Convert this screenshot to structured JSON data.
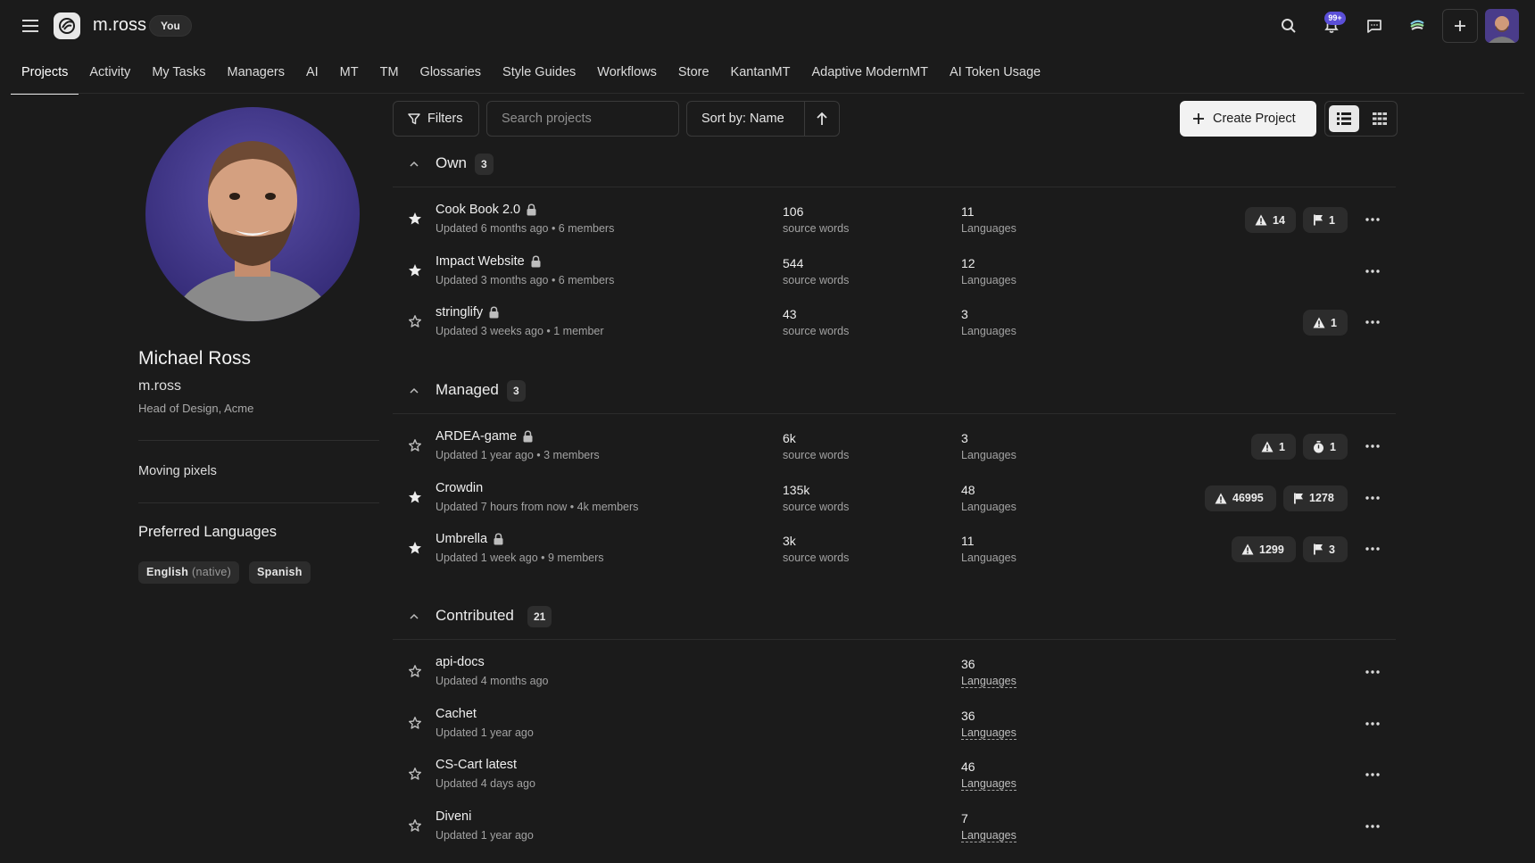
{
  "header": {
    "username": "m.ross",
    "you_badge": "You",
    "notifications_badge": "99+"
  },
  "nav": {
    "tabs": [
      "Projects",
      "Activity",
      "My Tasks",
      "Managers",
      "AI",
      "MT",
      "TM",
      "Glossaries",
      "Style Guides",
      "Workflows",
      "Store",
      "KantanMT",
      "Adaptive ModernMT",
      "AI Token Usage"
    ],
    "active": "Projects"
  },
  "profile": {
    "name": "Michael Ross",
    "handle": "m.ross",
    "title": "Head of Design, Acme",
    "bio": "Moving pixels",
    "preferred_heading": "Preferred Languages",
    "languages": [
      {
        "label": "English",
        "note": "(native)"
      },
      {
        "label": "Spanish",
        "note": ""
      }
    ]
  },
  "toolbar": {
    "filters_label": "Filters",
    "search_placeholder": "Search projects",
    "sort_label": "Sort by: Name",
    "create_label": "Create Project"
  },
  "sections": [
    {
      "title": "Own",
      "count": "3",
      "projects": [
        {
          "name": "Cook Book 2.0",
          "locked": true,
          "starred": true,
          "meta": "Updated 6 months ago • 6 members",
          "words": "106",
          "words_label": "source words",
          "langs": "11",
          "langs_label": "Languages",
          "pills": [
            {
              "icon": "warning-icon",
              "value": "14"
            },
            {
              "icon": "flag-icon",
              "value": "1"
            }
          ]
        },
        {
          "name": "Impact Website",
          "locked": true,
          "starred": true,
          "meta": "Updated 3 months ago • 6 members",
          "words": "544",
          "words_label": "source words",
          "langs": "12",
          "langs_label": "Languages",
          "pills": []
        },
        {
          "name": "stringlify",
          "locked": true,
          "starred": false,
          "meta": "Updated 3 weeks ago • 1 member",
          "words": "43",
          "words_label": "source words",
          "langs": "3",
          "langs_label": "Languages",
          "pills": [
            {
              "icon": "warning-icon",
              "value": "1"
            }
          ]
        }
      ]
    },
    {
      "title": "Managed",
      "count": "3",
      "projects": [
        {
          "name": "ARDEA-game",
          "locked": true,
          "starred": false,
          "meta": "Updated 1 year ago • 3 members",
          "words": "6k",
          "words_label": "source words",
          "langs": "3",
          "langs_label": "Languages",
          "pills": [
            {
              "icon": "warning-icon",
              "value": "1"
            },
            {
              "icon": "timer-icon",
              "value": "1"
            }
          ]
        },
        {
          "name": "Crowdin",
          "locked": false,
          "starred": true,
          "meta": "Updated 7 hours from now • 4k members",
          "words": "135k",
          "words_label": "source words",
          "langs": "48",
          "langs_label": "Languages",
          "pills": [
            {
              "icon": "warning-icon",
              "value": "46995"
            },
            {
              "icon": "flag-icon",
              "value": "1278"
            }
          ]
        },
        {
          "name": "Umbrella",
          "locked": true,
          "starred": true,
          "meta": "Updated 1 week ago • 9 members",
          "words": "3k",
          "words_label": "source words",
          "langs": "11",
          "langs_label": "Languages",
          "pills": [
            {
              "icon": "warning-icon",
              "value": "1299"
            },
            {
              "icon": "flag-icon",
              "value": "3"
            }
          ]
        }
      ]
    },
    {
      "title": "Contributed",
      "count": "21",
      "projects": [
        {
          "name": "api-docs",
          "locked": false,
          "starred": false,
          "meta": "Updated 4 months ago",
          "words": "",
          "words_label": "",
          "langs": "36",
          "langs_label": "Languages",
          "dashed": true,
          "pills": []
        },
        {
          "name": "Cachet",
          "locked": false,
          "starred": false,
          "meta": "Updated 1 year ago",
          "words": "",
          "words_label": "",
          "langs": "36",
          "langs_label": "Languages",
          "dashed": true,
          "pills": []
        },
        {
          "name": "CS-Cart latest",
          "locked": false,
          "starred": false,
          "meta": "Updated 4 days ago",
          "words": "",
          "words_label": "",
          "langs": "46",
          "langs_label": "Languages",
          "dashed": true,
          "pills": []
        },
        {
          "name": "Diveni",
          "locked": false,
          "starred": false,
          "meta": "Updated 1 year ago",
          "words": "",
          "words_label": "",
          "langs": "7",
          "langs_label": "Languages",
          "dashed": true,
          "pills": []
        }
      ]
    }
  ]
}
